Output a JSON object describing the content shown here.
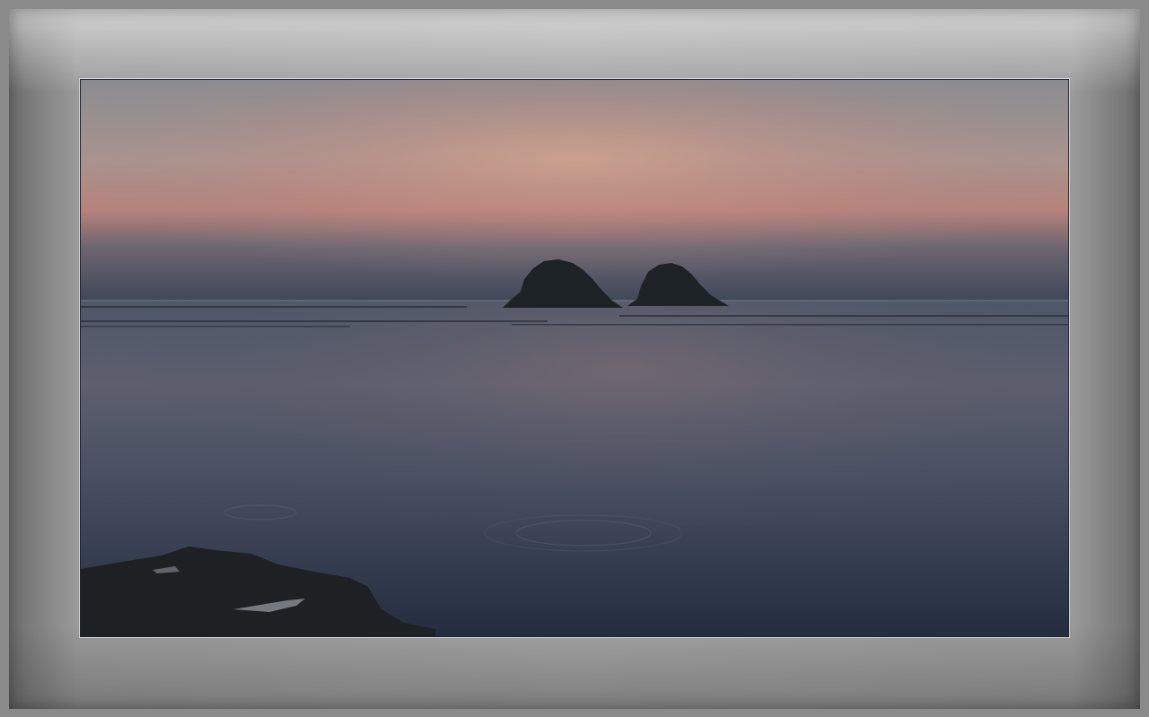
{
  "image": {
    "subject": "sea-islands-sunset",
    "colors": {
      "sky_top": "#8c8f93",
      "sky_glow": "#c99a86",
      "sky_horizon": "#3f4a5c",
      "sea_top": "#4b5566",
      "sea_mid": "#5a5d6c",
      "sea_bottom": "#273244",
      "island": "#1d2428",
      "rock": "#1e2124"
    }
  }
}
